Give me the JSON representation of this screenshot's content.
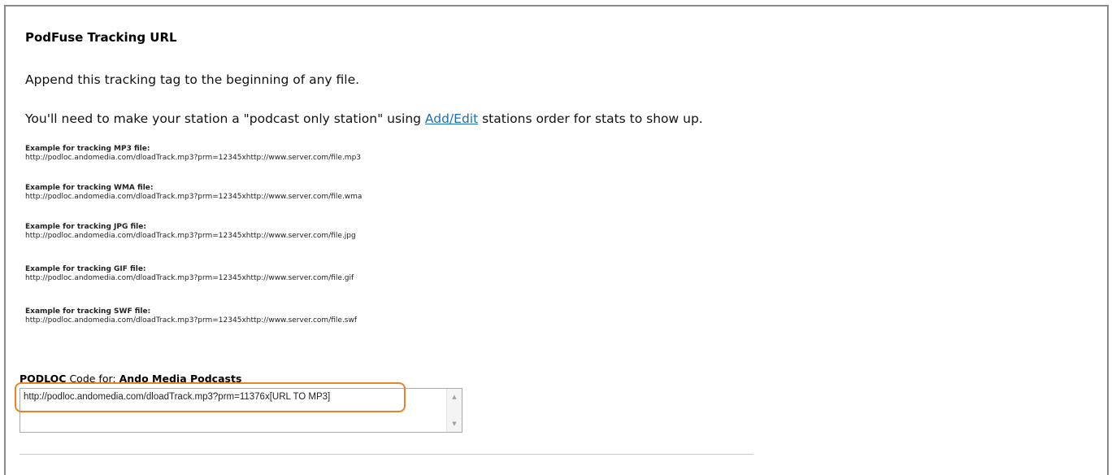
{
  "header": {
    "title": "PodFuse Tracking URL"
  },
  "intro": {
    "text": "Append this tracking tag to the beginning of any file."
  },
  "note": {
    "before": "You'll need to make your station a \"podcast only station\" using ",
    "link": "Add/Edit",
    "after": " stations order for stats to show up."
  },
  "examples": [
    {
      "label": "Example for tracking MP3 file:",
      "url": "http://podloc.andomedia.com/dloadTrack.mp3?prm=12345xhttp://www.server.com/file.mp3"
    },
    {
      "label": "Example for tracking WMA file:",
      "url": "http://podloc.andomedia.com/dloadTrack.mp3?prm=12345xhttp://www.server.com/file.wma"
    },
    {
      "label": "Example for tracking JPG file:",
      "url": "http://podloc.andomedia.com/dloadTrack.mp3?prm=12345xhttp://www.server.com/file.jpg"
    },
    {
      "label": "Example for tracking GIF file:",
      "url": "http://podloc.andomedia.com/dloadTrack.mp3?prm=12345xhttp://www.server.com/file.gif"
    },
    {
      "label": "Example for tracking SWF file:",
      "url": "http://podloc.andomedia.com/dloadTrack.mp3?prm=12345xhttp://www.server.com/file.swf"
    }
  ],
  "podloc": {
    "label_bold": "PODLOC",
    "label_mid": " Code for: ",
    "station": "Ando Media Podcasts",
    "code": "http://podloc.andomedia.com/dloadTrack.mp3?prm=11376x[URL TO MP3]"
  },
  "colors": {
    "link": "#1a6fb5",
    "highlight": "#e8832a",
    "frame": "#8a8a8a"
  },
  "icons": {
    "scroll_up": "scroll-up-arrow-icon",
    "scroll_down": "scroll-down-arrow-icon"
  }
}
